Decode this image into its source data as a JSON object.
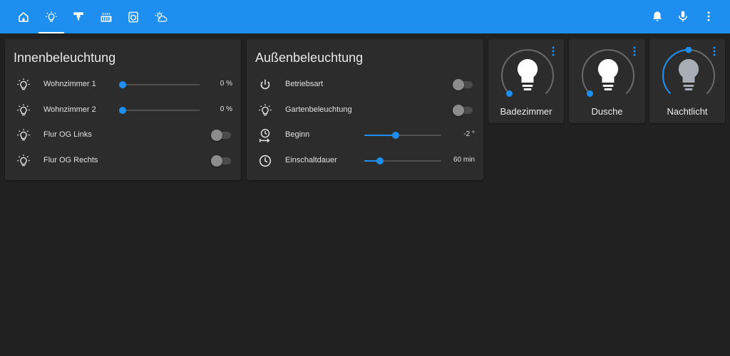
{
  "colors": {
    "accent": "#1e8ff0",
    "bulb_on": "#ffffff",
    "bulb_dim": "#a9adb6"
  },
  "topbar": {
    "tabs": [
      {
        "icon": "home-icon"
      },
      {
        "icon": "lightbulb-icon",
        "active": true
      },
      {
        "icon": "ceiling-lamp-icon"
      },
      {
        "icon": "radiator-icon"
      },
      {
        "icon": "washing-machine-icon"
      },
      {
        "icon": "weather-cloudy-icon"
      }
    ],
    "actions": [
      {
        "icon": "bell-icon"
      },
      {
        "icon": "microphone-icon"
      },
      {
        "icon": "more-vertical-icon"
      }
    ]
  },
  "innen": {
    "title": "Innenbeleuchtung",
    "rows": [
      {
        "label": "Wohnzimmer 1",
        "value": "0 %",
        "level": 0,
        "icon": "lightbulb-icon"
      },
      {
        "label": "Wohnzimmer 2",
        "value": "0 %",
        "level": 0,
        "icon": "lightbulb-icon"
      },
      {
        "label": "Flur OG Links",
        "on": false,
        "icon": "lightbulb-icon"
      },
      {
        "label": "Flur OG Rechts",
        "on": false,
        "icon": "lightbulb-icon"
      }
    ]
  },
  "aussen": {
    "title": "Außenbeleuchtung",
    "rows": [
      {
        "label": "Betriebsart",
        "on": false,
        "icon": "power-icon"
      },
      {
        "label": "Gartenbeleuchtung",
        "on": false,
        "icon": "lightbulb-icon"
      },
      {
        "label": "Beginn",
        "value": "-2 °",
        "level": 0.41,
        "icon": "timer-start-icon"
      },
      {
        "label": "Einschaltdauer",
        "value": "60 min",
        "level": 0.2,
        "icon": "clock-icon"
      }
    ]
  },
  "tiles": [
    {
      "name": "Badezimmer",
      "brightness": 0,
      "bulb": "on"
    },
    {
      "name": "Dusche",
      "brightness": 0,
      "bulb": "on"
    },
    {
      "name": "Nachtlicht",
      "brightness": 0.5,
      "bulb": "dim"
    }
  ]
}
